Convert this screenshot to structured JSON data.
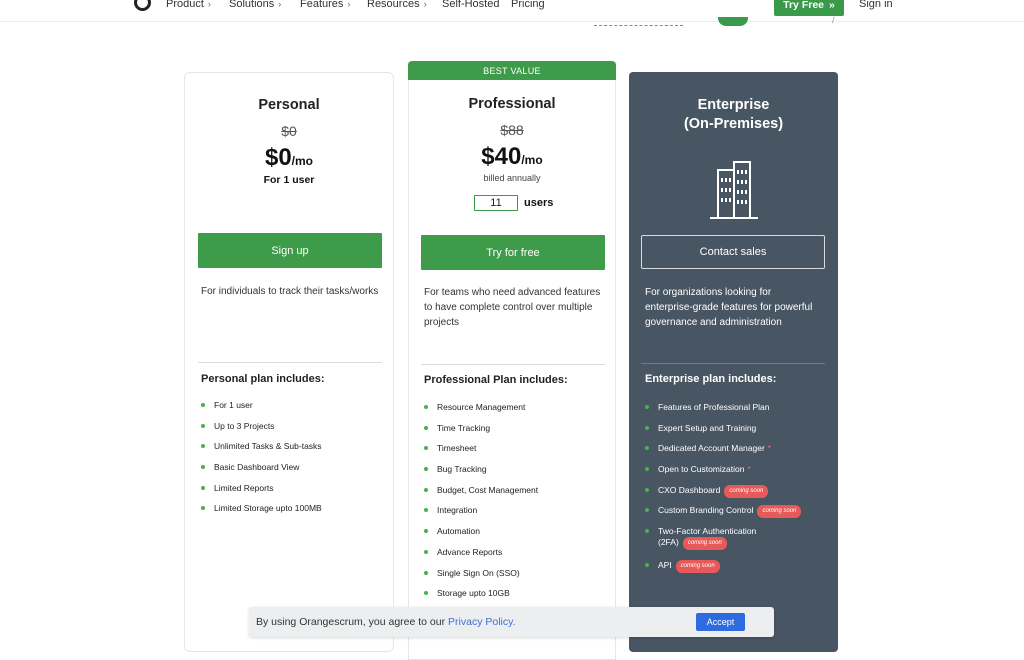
{
  "nav": {
    "items": [
      {
        "label": "Product",
        "has_chevron": true
      },
      {
        "label": "Solutions",
        "has_chevron": true
      },
      {
        "label": "Features",
        "has_chevron": true
      },
      {
        "label": "Resources",
        "has_chevron": true
      },
      {
        "label": "Self-Hosted",
        "has_chevron": false
      },
      {
        "label": "Pricing",
        "has_chevron": false
      }
    ],
    "try_free_label": "Try Free",
    "sign_in_label": "Sign in"
  },
  "personal": {
    "title": "Personal",
    "old_price": "$0",
    "price": "$0",
    "per": "/mo",
    "sub": "For 1 user",
    "button_label": "Sign up",
    "description": "For individuals to track their tasks/works",
    "includes_title": "Personal plan includes:",
    "features": [
      "For 1 user",
      "Up to 3 Projects",
      "Unlimited Tasks & Sub-tasks",
      "Basic Dashboard View",
      "Limited Reports",
      "Limited Storage upto 100MB"
    ]
  },
  "professional": {
    "banner": "BEST VALUE",
    "title": "Professional",
    "old_price": "$88",
    "price": "$40",
    "per": "/mo",
    "billed": "billed annually",
    "users_value": "11",
    "users_label": "users",
    "button_label": "Try for free",
    "description": "For teams who need advanced features to have complete control over multiple projects",
    "includes_title": "Professional Plan includes:",
    "features": [
      "Resource Management",
      "Time Tracking",
      "Timesheet",
      "Bug Tracking",
      "Budget, Cost Management",
      "Integration",
      "Automation",
      "Advance Reports",
      "Single Sign On (SSO)",
      "Storage upto 10GB"
    ]
  },
  "enterprise": {
    "title_line1": "Enterprise",
    "title_line2": "(On-Premises)",
    "icon": "building-icon",
    "button_label": "Contact sales",
    "description": "For organizations looking for enterprise-grade features for powerful governance and administration",
    "includes_title": "Enterprise plan includes:",
    "coming_soon_label": "coming soon",
    "features": [
      {
        "text": "Features of Professional Plan"
      },
      {
        "text": "Expert Setup and Training"
      },
      {
        "text": "Dedicated Account Manager",
        "asterisk": "*"
      },
      {
        "text": "Open to Customization",
        "asterisk": "*"
      },
      {
        "text": "CXO Dashboard",
        "coming_soon": true
      },
      {
        "text": "Custom Branding Control",
        "coming_soon": true
      },
      {
        "text": "Two-Factor Authentication",
        "text2": "(2FA)",
        "coming_soon": true
      },
      {
        "text": "API",
        "coming_soon": true
      }
    ]
  },
  "cookie": {
    "text": "By using Orangescrum, you agree to our ",
    "link": "Privacy Policy.",
    "accept_label": "Accept"
  },
  "colors": {
    "green": "#3e9b49",
    "enterprise_bg": "#485562",
    "accept_blue": "#2e6be0",
    "coming_soon_red": "#e85a5a"
  }
}
